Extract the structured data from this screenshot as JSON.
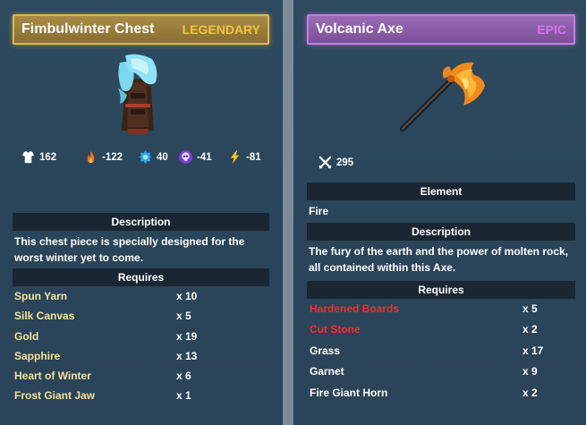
{
  "colors": {
    "legendary": "#f2c23c",
    "epic": "#d670f0",
    "missing_material": "#ff2a2a",
    "available_material_left": "#f2e29a"
  },
  "left_card": {
    "title": "Fimbulwinter Chest",
    "rarity": "LEGENDARY",
    "art_icon": "fur-chest-armor-icon",
    "stats": [
      {
        "icon": "armor-icon",
        "value": "162"
      },
      {
        "icon": "fire-icon",
        "value": "-122"
      },
      {
        "icon": "frost-icon",
        "value": "40"
      },
      {
        "icon": "poison-skull-icon",
        "value": "-41"
      },
      {
        "icon": "lightning-icon",
        "value": "-81"
      }
    ],
    "description_label": "Description",
    "description": "This chest piece is specially designed for the worst winter yet to come.",
    "requires_label": "Requires",
    "requirements": [
      {
        "name": "Spun Yarn",
        "qty": "x 10"
      },
      {
        "name": "Silk Canvas",
        "qty": "x 5"
      },
      {
        "name": "Gold",
        "qty": "x 19"
      },
      {
        "name": "Sapphire",
        "qty": "x 13"
      },
      {
        "name": "Heart of Winter",
        "qty": "x 6"
      },
      {
        "name": "Frost Giant Jaw",
        "qty": "x 1"
      }
    ]
  },
  "right_card": {
    "title": "Volcanic Axe",
    "rarity": "EPIC",
    "art_icon": "volcanic-axe-icon",
    "stats": [
      {
        "icon": "crossed-swords-icon",
        "value": "295"
      }
    ],
    "element_label": "Element",
    "element": "Fire",
    "description_label": "Description",
    "description": "The fury of the earth and the power of molten rock, all contained within this Axe.",
    "requires_label": "Requires",
    "requirements": [
      {
        "name": "Hardened Boards",
        "qty": "x 5",
        "status": "missing"
      },
      {
        "name": "Cut Stone",
        "qty": "x 2",
        "status": "missing"
      },
      {
        "name": "Grass",
        "qty": "x 17",
        "status": "available"
      },
      {
        "name": "Garnet",
        "qty": "x 9",
        "status": "available"
      },
      {
        "name": "Fire Giant Horn",
        "qty": "x 2",
        "status": "available"
      }
    ]
  }
}
